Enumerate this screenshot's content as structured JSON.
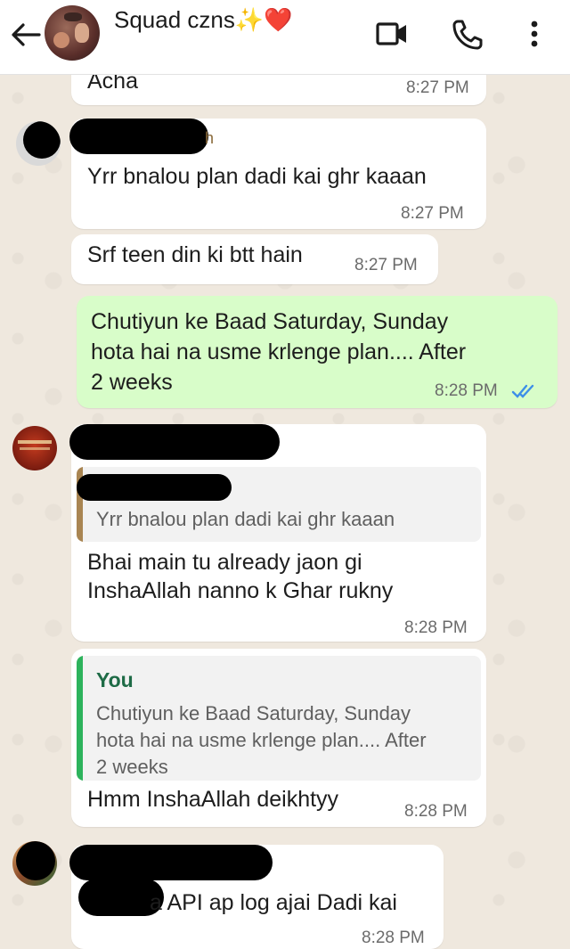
{
  "header": {
    "title": "Squad czns✨❤️",
    "back_icon": "arrow-left-icon",
    "actions": [
      "video-call-icon",
      "phone-call-icon",
      "more-vert-icon"
    ]
  },
  "colors": {
    "outgoing_bubble": "#d8fdc9",
    "incoming_bubble": "#ffffff",
    "read_ticks": "#3d8fe8",
    "quote_you_bar": "#2db35c",
    "quote_other_bar": "#a98552",
    "you_label": "#1e6b46"
  },
  "messages": [
    {
      "direction": "in",
      "text": "Acha",
      "time": "8:27 PM"
    },
    {
      "direction": "in",
      "sender": "[redacted]",
      "text": "Yrr bnalou plan dadi kai ghr kaaan",
      "time": "8:27 PM"
    },
    {
      "direction": "in",
      "text": "Srf teen din ki btt hain",
      "time": "8:27 PM"
    },
    {
      "direction": "out",
      "lines": [
        "Chutiyun ke Baad Saturday, Sunday",
        "hota hai na usme krlenge plan.... After",
        "2 weeks"
      ],
      "time": "8:28 PM",
      "status": "read"
    },
    {
      "direction": "in",
      "sender": "[redacted]",
      "quote": {
        "author": "[redacted]",
        "text": "Yrr bnalou plan dadi kai ghr kaaan"
      },
      "lines": [
        "Bhai main tu already jaon gi",
        "InshaAllah nanno k Ghar rukny"
      ],
      "time": "8:28 PM"
    },
    {
      "direction": "in",
      "quote": {
        "author": "You",
        "lines": [
          "Chutiyun ke Baad Saturday, Sunday",
          "hota hai na usme krlenge plan.... After",
          "2 weeks"
        ]
      },
      "text": "Hmm InshaAllah deikhtyy",
      "time": "8:28 PM"
    },
    {
      "direction": "in",
      "sender": "[redacted]",
      "text": "a API ap log ajai Dadi kai",
      "time": "8:28 PM"
    }
  ]
}
